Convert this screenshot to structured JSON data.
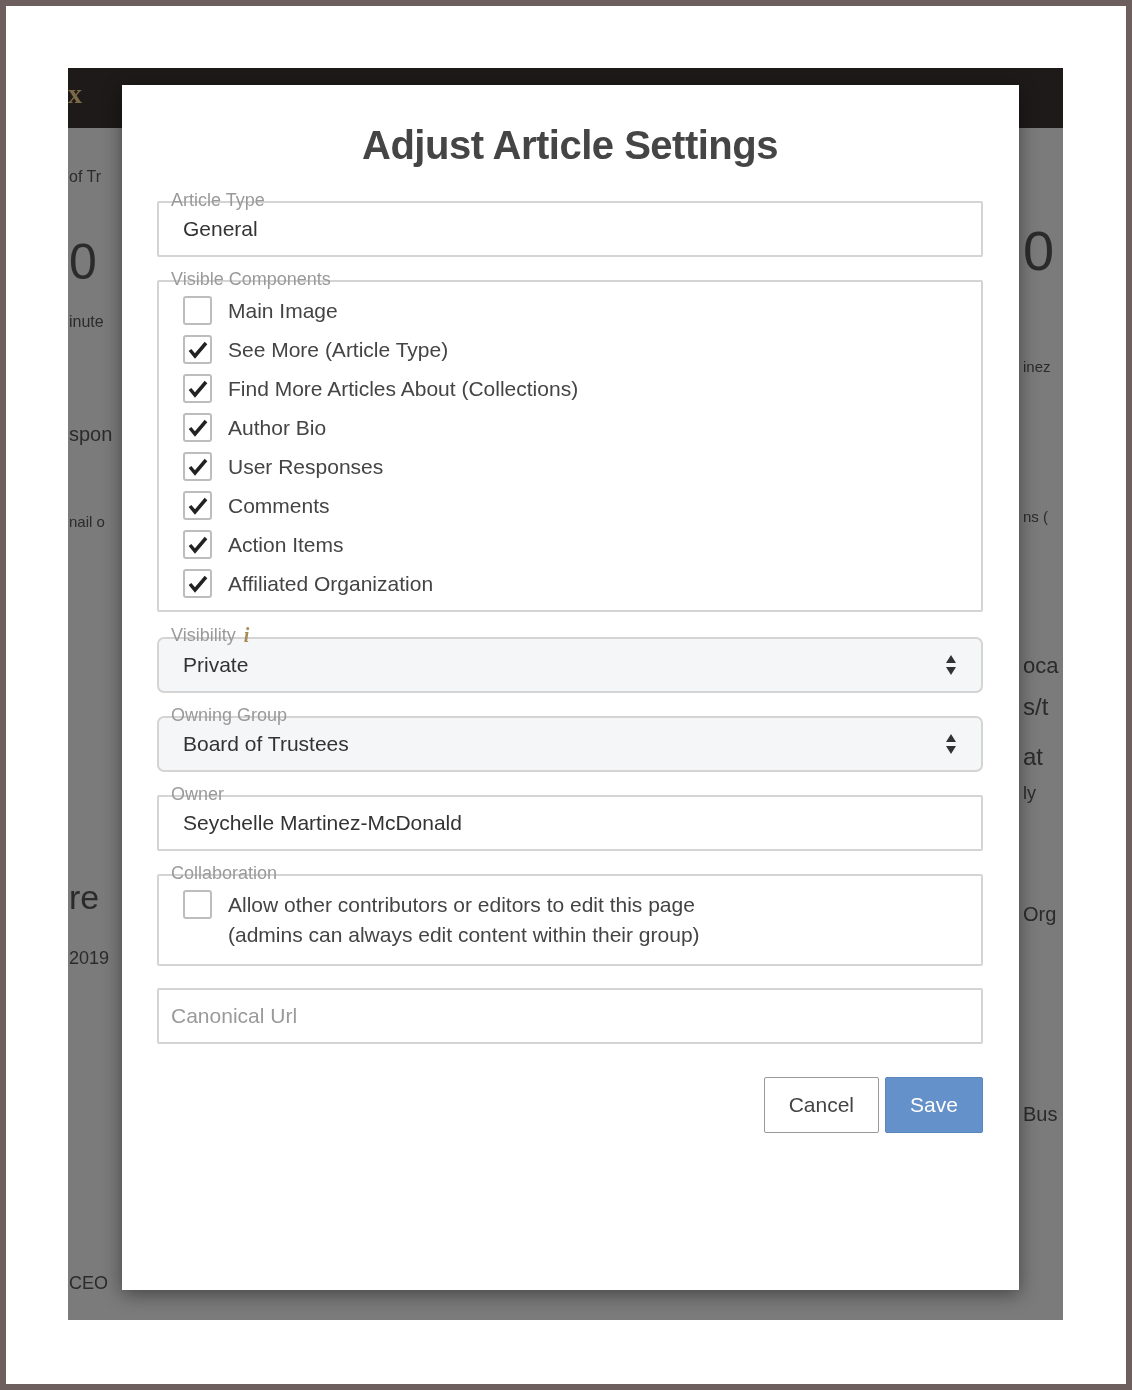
{
  "background": {
    "logo": "x",
    "left_fragments": [
      "of Tr",
      "0",
      "inute",
      "spon",
      "nail o",
      "re",
      "2019",
      "CEO"
    ],
    "right_fragments": [
      "0",
      "inez",
      "ns (",
      "oca",
      "s/t",
      "at",
      "ly",
      "Org",
      "Bus"
    ]
  },
  "dialog": {
    "title": "Adjust Article Settings",
    "article_type": {
      "label": "Article Type",
      "value": "General"
    },
    "visible_components": {
      "label": "Visible Components",
      "items": [
        {
          "label": "Main Image",
          "checked": false
        },
        {
          "label": "See More (Article Type)",
          "checked": true
        },
        {
          "label": "Find More Articles About (Collections)",
          "checked": true
        },
        {
          "label": "Author Bio",
          "checked": true
        },
        {
          "label": "User Responses",
          "checked": true
        },
        {
          "label": "Comments",
          "checked": true
        },
        {
          "label": "Action Items",
          "checked": true
        },
        {
          "label": "Affiliated Organization",
          "checked": true
        }
      ]
    },
    "visibility": {
      "label": "Visibility",
      "hint_mark": "i",
      "value": "Private"
    },
    "owning_group": {
      "label": "Owning Group",
      "value": "Board of Trustees"
    },
    "owner": {
      "label": "Owner",
      "value": "Seychelle Martinez-McDonald"
    },
    "collaboration": {
      "label": "Collaboration",
      "checked": false,
      "text_lines": [
        "Allow other contributors or editors to edit this page",
        "(admins can always edit content within their group)"
      ]
    },
    "canonical_url": {
      "placeholder": "Canonical Url"
    },
    "buttons": [
      {
        "label": "Cancel",
        "kind": "secondary"
      },
      {
        "label": "Save",
        "kind": "primary"
      }
    ]
  }
}
